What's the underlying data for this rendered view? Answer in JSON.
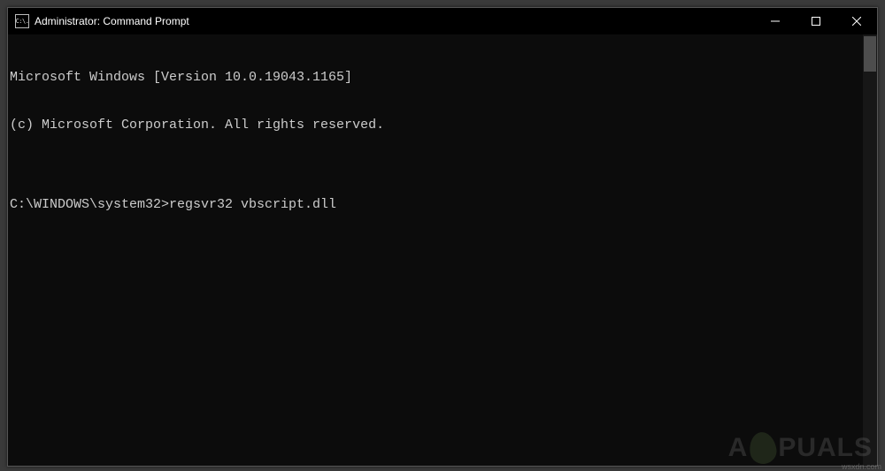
{
  "window": {
    "title": "Administrator: Command Prompt",
    "icon_glyph": "C:\\."
  },
  "terminal": {
    "lines": [
      "Microsoft Windows [Version 10.0.19043.1165]",
      "(c) Microsoft Corporation. All rights reserved.",
      ""
    ],
    "prompt": "C:\\WINDOWS\\system32>",
    "command": "regsvr32 vbscript.dll"
  },
  "watermark": {
    "left": "A",
    "right": "PUALS"
  },
  "source": "wsxdn.com"
}
